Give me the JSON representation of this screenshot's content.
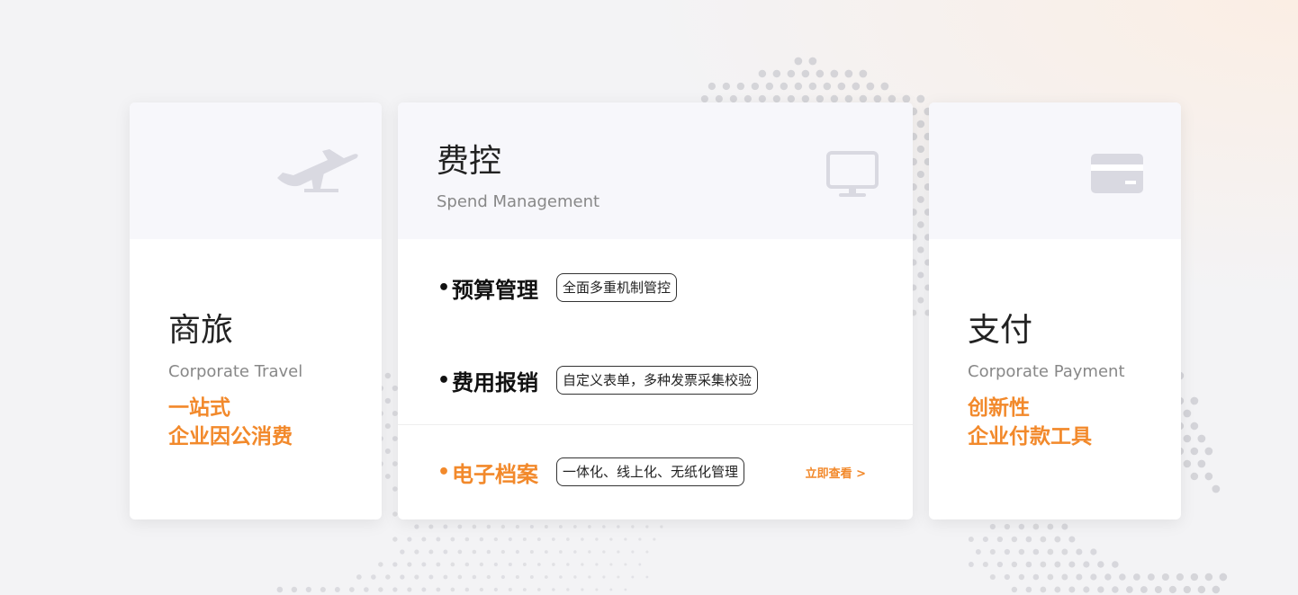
{
  "cards": {
    "travel": {
      "title": "商旅",
      "subtitle": "Corporate Travel",
      "highlight_line1": "一站式",
      "highlight_line2": "企业因公消费",
      "icon": "airplane-icon"
    },
    "spend": {
      "title": "费控",
      "subtitle": "Spend Management",
      "icon": "monitor-icon",
      "features": [
        {
          "bullet": "•",
          "name": "预算管理",
          "tag": "全面多重机制管控",
          "active": false
        },
        {
          "bullet": "•",
          "name": "费用报销",
          "tag": "自定义表单，多种发票采集校验",
          "active": false
        },
        {
          "bullet": "•",
          "name": "电子档案",
          "tag": "一体化、线上化、无纸化管理",
          "active": true
        }
      ],
      "view_link": "立即查看 >"
    },
    "payment": {
      "title": "支付",
      "subtitle": "Corporate Payment",
      "highlight_line1": "创新性",
      "highlight_line2": "企业付款工具",
      "icon": "credit-card-icon"
    }
  },
  "colors": {
    "accent": "#f2892b",
    "card_header": "#f7f7fb",
    "icon_gray": "#d9d9e1"
  }
}
